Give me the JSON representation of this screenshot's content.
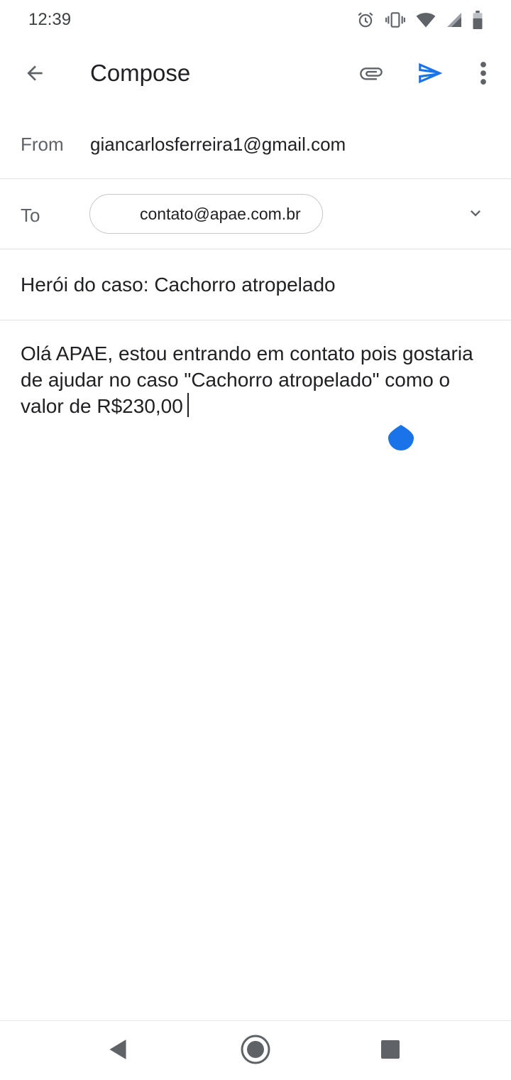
{
  "status_bar": {
    "time": "12:39",
    "icons": [
      "alarm-icon",
      "vibrate-icon",
      "wifi-icon",
      "signal-icon",
      "battery-icon"
    ]
  },
  "app_bar": {
    "title": "Compose",
    "icons": [
      "back-arrow-icon",
      "paperclip-icon",
      "send-icon",
      "more-vert-icon"
    ],
    "accent_color": "#1a73e8"
  },
  "compose": {
    "from_label": "From",
    "from_value": "giancarlosferreira1@gmail.com",
    "to_label": "To",
    "to_chip": "contato@apae.com.br",
    "subject": "Herói do caso: Cachorro atropelado",
    "body": "Olá APAE, estou entrando em contato pois gostaria de ajudar no caso \"Cachorro atropelado\" como o valor de R$230,00"
  },
  "nav_bar": {
    "icons": [
      "nav-back-icon",
      "nav-home-icon",
      "nav-recents-icon"
    ]
  }
}
